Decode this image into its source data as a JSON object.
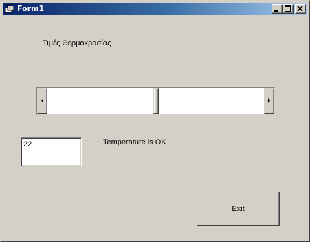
{
  "window": {
    "title": "Form1",
    "icon": "form-app-icon",
    "controls": [
      "minimize-icon",
      "maximize-icon",
      "close-icon"
    ]
  },
  "labels": {
    "heading": "Τιμές Θερμοκρασίας",
    "status": "Temperature is OK"
  },
  "temperature_scrollbar": {
    "value_fraction": 0.5,
    "left_arrow_icon": "arrow-left-icon",
    "right_arrow_icon": "arrow-right-icon"
  },
  "temperature_input": {
    "value": "22"
  },
  "exit_button": {
    "label": "Exit"
  },
  "colors": {
    "face": "#d4d0c8",
    "titlebar_start": "#0a246a",
    "titlebar_end": "#a6caf0",
    "title_text": "#ffffff",
    "field_background": "#ffffff"
  }
}
